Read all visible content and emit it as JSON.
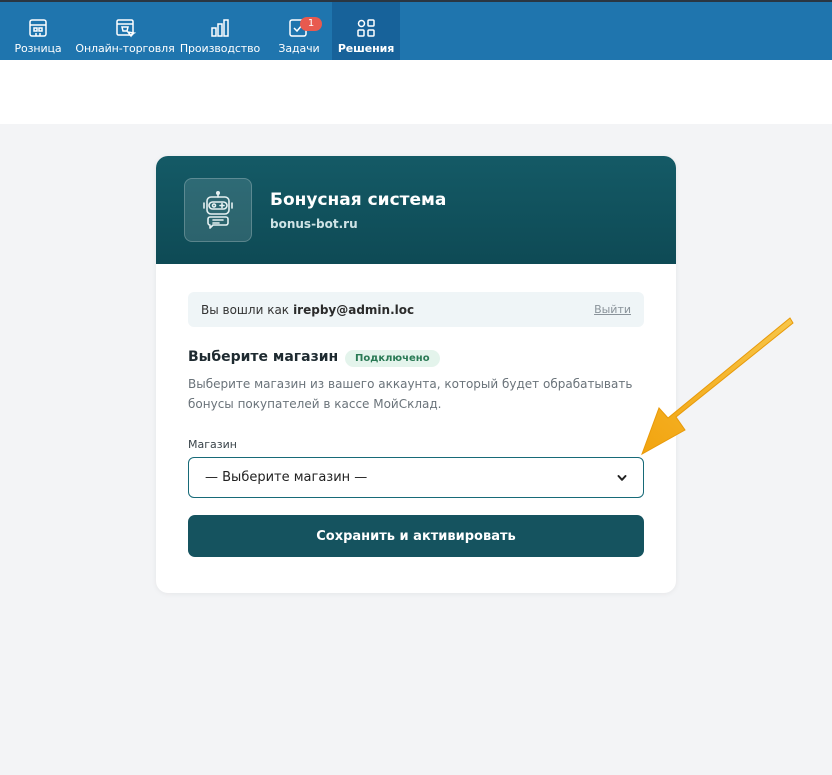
{
  "nav": {
    "items": [
      {
        "label": "Розница",
        "icon": "store-icon"
      },
      {
        "label": "Онлайн-торговля",
        "icon": "online-shop-icon"
      },
      {
        "label": "Производство",
        "icon": "production-icon"
      },
      {
        "label": "Задачи",
        "icon": "tasks-icon",
        "badge": "1"
      },
      {
        "label": "Решения",
        "icon": "solutions-icon",
        "active": true
      }
    ]
  },
  "app": {
    "title": "Бонусная система",
    "domain": "bonus-bot.ru"
  },
  "login": {
    "prefix": "Вы вошли как",
    "email": "irepby@admin.loc",
    "logout_label": "Выйти"
  },
  "store_section": {
    "title": "Выберите магазин",
    "status": "Подключено",
    "description": "Выберите магазин из вашего аккаунта, который будет обрабатывать бонусы покупателей в кассе МойСклад."
  },
  "store_field": {
    "label": "Магазин",
    "selected": "— Выберите магазин —"
  },
  "actions": {
    "save_label": "Сохранить и активировать"
  },
  "colors": {
    "topbar": "#1f75ae",
    "header": "#145a66",
    "button": "#15535f",
    "arrow": "#f5b01e",
    "badge": "#e85a4f"
  }
}
